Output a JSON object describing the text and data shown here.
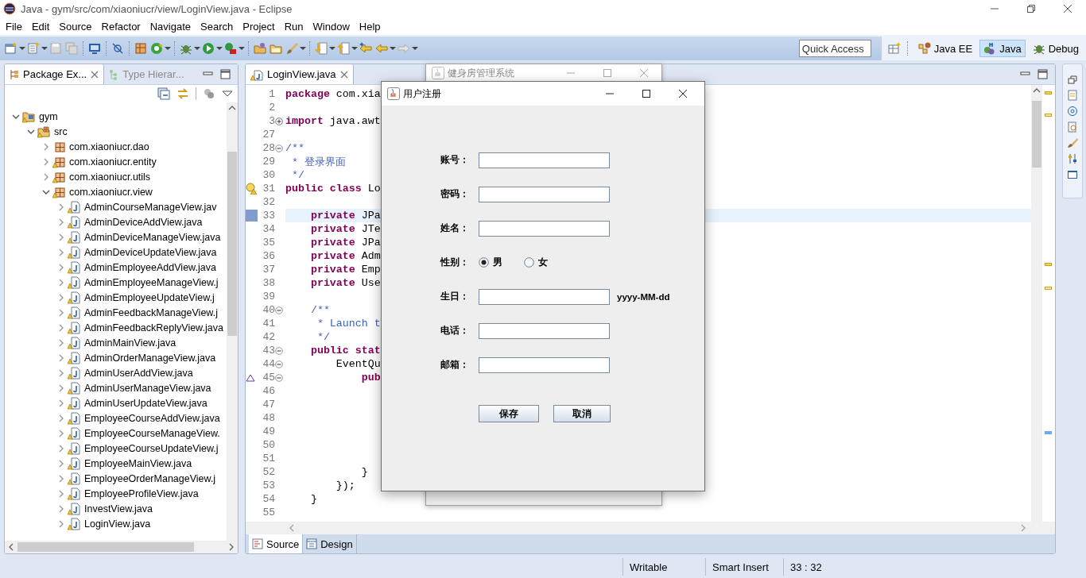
{
  "window": {
    "title": "Java - gym/src/com/xiaoniucr/view/LoginView.java - Eclipse"
  },
  "menu": [
    "File",
    "Edit",
    "Source",
    "Refactor",
    "Navigate",
    "Search",
    "Project",
    "Run",
    "Window",
    "Help"
  ],
  "quick_access": {
    "placeholder": "Quick Access"
  },
  "perspectives": [
    {
      "label": "Java EE",
      "selected": false
    },
    {
      "label": "Java",
      "selected": true
    },
    {
      "label": "Debug",
      "selected": false
    }
  ],
  "explorer": {
    "tabs": [
      {
        "label": "Package Ex...",
        "selected": true
      },
      {
        "label": "Type Hierar...",
        "selected": false
      }
    ],
    "tree": [
      {
        "label": "gym",
        "kind": "project",
        "warning": true,
        "expanded": true,
        "children": [
          {
            "label": "src",
            "kind": "source",
            "warning": true,
            "expanded": true,
            "children": [
              {
                "label": "com.xiaoniucr.dao",
                "kind": "package",
                "warning": false,
                "expanded": false
              },
              {
                "label": "com.xiaoniucr.entity",
                "kind": "package",
                "warning": true,
                "expanded": false
              },
              {
                "label": "com.xiaoniucr.utils",
                "kind": "package",
                "warning": true,
                "expanded": false
              },
              {
                "label": "com.xiaoniucr.view",
                "kind": "package",
                "warning": true,
                "expanded": true,
                "children": [
                  {
                    "label": "AdminCourseManageView.jav",
                    "kind": "file",
                    "warning": true,
                    "expanded": false
                  },
                  {
                    "label": "AdminDeviceAddView.java",
                    "kind": "file",
                    "warning": true,
                    "expanded": false
                  },
                  {
                    "label": "AdminDeviceManageView.java",
                    "kind": "file",
                    "warning": true,
                    "expanded": false
                  },
                  {
                    "label": "AdminDeviceUpdateView.java",
                    "kind": "file",
                    "warning": true,
                    "expanded": false
                  },
                  {
                    "label": "AdminEmployeeAddView.java",
                    "kind": "file",
                    "warning": true,
                    "expanded": false
                  },
                  {
                    "label": "AdminEmployeeManageView.j",
                    "kind": "file",
                    "warning": true,
                    "expanded": false
                  },
                  {
                    "label": "AdminEmployeeUpdateView.j",
                    "kind": "file",
                    "warning": true,
                    "expanded": false
                  },
                  {
                    "label": "AdminFeedbackManageView.j",
                    "kind": "file",
                    "warning": true,
                    "expanded": false
                  },
                  {
                    "label": "AdminFeedbackReplyView.java",
                    "kind": "file",
                    "warning": true,
                    "expanded": false
                  },
                  {
                    "label": "AdminMainView.java",
                    "kind": "file",
                    "warning": true,
                    "expanded": false
                  },
                  {
                    "label": "AdminOrderManageView.java",
                    "kind": "file",
                    "warning": true,
                    "expanded": false
                  },
                  {
                    "label": "AdminUserAddView.java",
                    "kind": "file",
                    "warning": true,
                    "expanded": false
                  },
                  {
                    "label": "AdminUserManageView.java",
                    "kind": "file",
                    "warning": true,
                    "expanded": false
                  },
                  {
                    "label": "AdminUserUpdateView.java",
                    "kind": "file",
                    "warning": true,
                    "expanded": false
                  },
                  {
                    "label": "EmployeeCourseAddView.java",
                    "kind": "file",
                    "warning": true,
                    "expanded": false
                  },
                  {
                    "label": "EmployeeCourseManageView.",
                    "kind": "file",
                    "warning": true,
                    "expanded": false
                  },
                  {
                    "label": "EmployeeCourseUpdateView.j",
                    "kind": "file",
                    "warning": true,
                    "expanded": false
                  },
                  {
                    "label": "EmployeeMainView.java",
                    "kind": "file",
                    "warning": true,
                    "expanded": false
                  },
                  {
                    "label": "EmployeeOrderManageView.j",
                    "kind": "file",
                    "warning": true,
                    "expanded": false
                  },
                  {
                    "label": "EmployeeProfileView.java",
                    "kind": "file",
                    "warning": true,
                    "expanded": false
                  },
                  {
                    "label": "InvestView.java",
                    "kind": "file",
                    "warning": true,
                    "expanded": false
                  },
                  {
                    "label": "LoginView.java",
                    "kind": "file",
                    "warning": true,
                    "expanded": false
                  }
                ]
              }
            ]
          }
        ]
      }
    ]
  },
  "editor": {
    "tabs": [
      {
        "label": "LoginView.java",
        "selected": true
      }
    ],
    "lines": [
      {
        "num": "1",
        "text": "**package** com.xia",
        "kind": "code",
        "current": false
      },
      {
        "num": "2",
        "current": false
      },
      {
        "num": "3",
        "text": "**import** java.awt",
        "kind": "code",
        "expanded": false,
        "current": false
      },
      {
        "num": "27",
        "current": false
      },
      {
        "num": "28",
        "text": "/**",
        "kind": "comment",
        "expanded": true,
        "current": false
      },
      {
        "num": "29",
        "text": " * 登录界面",
        "kind": "comment",
        "current": false
      },
      {
        "num": "30",
        "text": " */",
        "kind": "comment",
        "current": false
      },
      {
        "num": "31",
        "text": "**public class** Lo",
        "kind": "code",
        "warning": true,
        "current": false
      },
      {
        "num": "32",
        "current": false
      },
      {
        "num": "33",
        "text": "    **private** JPa",
        "kind": "code",
        "marked": true,
        "current": true
      },
      {
        "num": "34",
        "text": "    **private** JTe",
        "kind": "code",
        "current": false
      },
      {
        "num": "35",
        "text": "    **private** JPa",
        "kind": "code",
        "current": false
      },
      {
        "num": "36",
        "text": "    **private** Adm",
        "kind": "code",
        "current": false
      },
      {
        "num": "37",
        "text": "    **private** Emp",
        "kind": "code",
        "current": false
      },
      {
        "num": "38",
        "text": "    **private** Use",
        "kind": "code",
        "current": false
      },
      {
        "num": "39",
        "current": false
      },
      {
        "num": "40",
        "text": "    /**",
        "kind": "comment",
        "expanded": true,
        "current": false
      },
      {
        "num": "41",
        "text": "     * Launch t",
        "kind": "comment",
        "current": false
      },
      {
        "num": "42",
        "text": "     */",
        "kind": "comment",
        "current": false
      },
      {
        "num": "43",
        "text": "    **public stat**",
        "kind": "code",
        "expanded": true,
        "current": false
      },
      {
        "num": "44",
        "text": "        EventQu",
        "kind": "code",
        "expanded": true,
        "current": false
      },
      {
        "num": "45",
        "text": "            **pub**",
        "kind": "code",
        "expanded": true,
        "overrides": true,
        "current": false
      },
      {
        "num": "46",
        "current": false
      },
      {
        "num": "47",
        "current": false
      },
      {
        "num": "48",
        "current": false
      },
      {
        "num": "49",
        "current": false
      },
      {
        "num": "50",
        "current": false
      },
      {
        "num": "51",
        "current": false
      },
      {
        "num": "52",
        "text": "            }",
        "kind": "code",
        "current": false
      },
      {
        "num": "53",
        "text": "        });",
        "kind": "code",
        "current": false
      },
      {
        "num": "54",
        "text": "    }",
        "kind": "code",
        "current": false
      },
      {
        "num": "55",
        "current": false
      }
    ],
    "bottom_tabs": [
      {
        "label": "Source",
        "selected": true
      },
      {
        "label": "Design",
        "selected": false
      }
    ]
  },
  "background_window": {
    "title": "健身房管理系统"
  },
  "dialog": {
    "title": "用户注册",
    "fields": [
      {
        "label": "账号：",
        "kind": "text"
      },
      {
        "label": "密码：",
        "kind": "text"
      },
      {
        "label": "姓名：",
        "kind": "text"
      },
      {
        "label": "性别：",
        "kind": "radio",
        "options": [
          {
            "label": "男",
            "selected": true
          },
          {
            "label": "女",
            "selected": false
          }
        ]
      },
      {
        "label": "生日：",
        "kind": "text",
        "note": "yyyy-MM-dd"
      },
      {
        "label": "电话：",
        "kind": "text"
      },
      {
        "label": "邮箱：",
        "kind": "text"
      }
    ],
    "buttons": [
      "保存",
      "取消"
    ]
  },
  "status_bar": [
    "Writable",
    "Smart Insert",
    "33 : 32"
  ]
}
